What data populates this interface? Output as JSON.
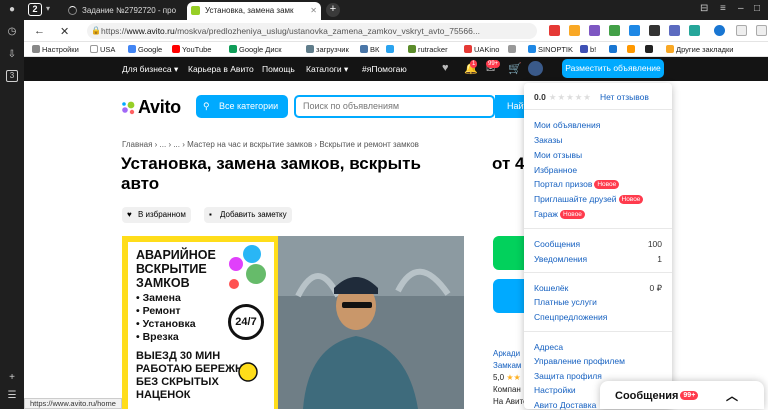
{
  "browser": {
    "tab_count": "2",
    "tabs": [
      {
        "title": "Задание №2792720 - про"
      },
      {
        "title": "Установка, замена замк"
      }
    ],
    "url": "https://www.avito.ru/moskva/predlozheniya_uslug/ustanovka_zamena_zamkov_vskryt_avto_75566...",
    "url_domain": "www.avito.ru",
    "url_path": "/moskva/predlozheniya_uslug/ustanovka_zamena_zamkov_vskryt_avto_75566...",
    "url_scheme": "https://"
  },
  "bookmarks": [
    {
      "label": "Настройки",
      "color": "#888888"
    },
    {
      "label": "USA",
      "color": "#ffffff"
    },
    {
      "label": "Google",
      "color": "#4285f4"
    },
    {
      "label": "YouTube",
      "color": "#ff0000"
    },
    {
      "label": "Google Диск",
      "color": "#0f9d58"
    },
    {
      "label": "загрузчик",
      "color": "#607d8b"
    },
    {
      "label": "ВК",
      "color": "#4a76a8"
    },
    {
      "label": "",
      "color": "#2aa3ef"
    },
    {
      "label": "rutracker",
      "color": "#5b8c2a"
    },
    {
      "label": "UAKino",
      "color": "#e53935"
    },
    {
      "label": "",
      "color": "#999999"
    },
    {
      "label": "SINOPTIK",
      "color": "#1e88e5"
    },
    {
      "label": "b!",
      "color": "#3f51b5"
    },
    {
      "label": "Другие закладки",
      "color": "#f9a825"
    }
  ],
  "avito_menu": [
    "Для бизнеса",
    "Карьера в Авито",
    "Помощь",
    "Каталоги",
    "#яПомогаю"
  ],
  "header": {
    "notif_badge": "1",
    "msg_badge": "99+",
    "post_ad": "Разместить объявление"
  },
  "search": {
    "logo": "Avito",
    "categories": "Все категории",
    "placeholder": "Поиск по объявлениям",
    "find": "Найти"
  },
  "breadcrumbs": "Главная  ›  ...  ›  ...  ›  Мастер на час и вскрытие замков  ›  Вскрытие и ремонт замков",
  "listing": {
    "title": "Установка, замена замков, вскрыть авто",
    "price": "от 4",
    "favorites": "В избранном",
    "add_note": "Добавить заметку",
    "ad_heading": "АВАРИЙНОЕ ВСКРЫТИЕ ЗАМКОВ",
    "ad_services": [
      "Замена",
      "Ремонт",
      "Установка",
      "Врезка"
    ],
    "ad_badge": "24/7",
    "ad_footer": "ВЫЕЗД 30 МИН РАБОТАЮ БЕРЕЖНО БЕЗ СКРЫТЫХ НАЦЕНОК",
    "seller_lines": [
      "Аркади",
      "Замкам",
      "5,0",
      "Компан",
      "На Авито"
    ]
  },
  "dropdown": {
    "rating_value": "0.0",
    "rating_stars": "★★★★★",
    "reviews": "Нет отзывов",
    "items_a": [
      "Мои объявления",
      "Заказы",
      "Мои отзывы",
      "Избранное"
    ],
    "items_b": [
      {
        "label": "Портал призов",
        "badge": "Новое"
      },
      {
        "label": "Приглашайте друзей",
        "badge": "Новое"
      },
      {
        "label": "Гараж",
        "badge": "Новое"
      }
    ],
    "items_c": [
      {
        "label": "Сообщения",
        "count": "100"
      },
      {
        "label": "Уведомления",
        "count": "1"
      }
    ],
    "items_d": [
      {
        "label": "Кошелёк",
        "count": "0 ₽"
      },
      {
        "label": "Платные услуги",
        "count": ""
      },
      {
        "label": "Спецпредложения",
        "count": ""
      }
    ],
    "items_e": [
      "Адреса",
      "Управление профилем",
      "Защита профиля",
      "Настройки",
      "Авито Доставка"
    ]
  },
  "messages": {
    "label": "Сообщения",
    "badge": "99+"
  },
  "status_url": "https://www.avito.ru/home"
}
